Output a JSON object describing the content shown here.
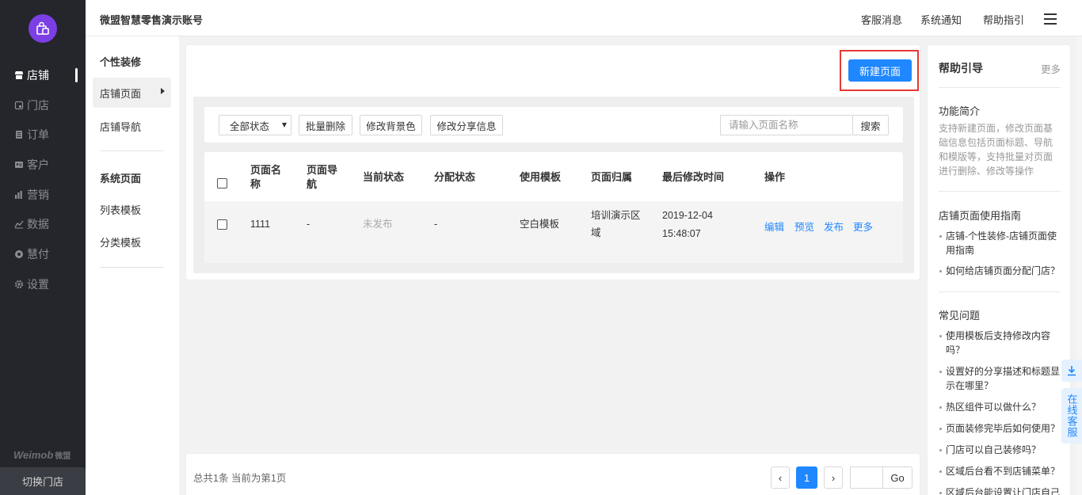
{
  "sidebar": {
    "items": [
      {
        "label": "店铺",
        "icon": "store-icon",
        "active": true
      },
      {
        "label": "门店",
        "icon": "shop-icon",
        "active": false
      },
      {
        "label": "订单",
        "icon": "order-icon",
        "active": false
      },
      {
        "label": "客户",
        "icon": "customer-icon",
        "active": false
      },
      {
        "label": "营销",
        "icon": "marketing-icon",
        "active": false
      },
      {
        "label": "数据",
        "icon": "data-icon",
        "active": false
      },
      {
        "label": "慧付",
        "icon": "pay-icon",
        "active": false
      },
      {
        "label": "设置",
        "icon": "settings-icon",
        "active": false
      }
    ],
    "brand": "Weimob",
    "brand_cn": "微盟",
    "switch_store": "切换门店"
  },
  "topbar": {
    "account_name": "微盟智慧零售演示账号",
    "links": [
      "客服消息",
      "系统通知",
      "帮助指引"
    ]
  },
  "submenu": {
    "head1": "个性装修",
    "items1": [
      "店铺页面",
      "店铺导航"
    ],
    "head2": "系统页面",
    "items2": [
      "列表模板",
      "分类模板"
    ]
  },
  "main": {
    "new_page_button": "新建页面",
    "filters": {
      "status_select": "全部状态",
      "batch_delete": "批量删除",
      "change_bg": "修改背景色",
      "change_share": "修改分享信息",
      "search_placeholder": "请输入页面名称",
      "search_button": "搜索"
    },
    "table": {
      "headers": [
        "页面名称",
        "页面导航",
        "当前状态",
        "分配状态",
        "使用模板",
        "页面归属",
        "最后修改时间",
        "操作"
      ],
      "rows": [
        {
          "name": "1111",
          "nav": "-",
          "status": "未发布",
          "assign": "-",
          "template": "空白模板",
          "owner": "培训演示区域",
          "modified_date": "2019-12-04",
          "modified_time": "15:48:07",
          "actions": [
            "编辑",
            "预览",
            "发布",
            "更多"
          ]
        }
      ]
    }
  },
  "pagination": {
    "info": "总共1条 当前为第1页",
    "prev": "‹",
    "current": "1",
    "next": "›",
    "go": "Go"
  },
  "help": {
    "title": "帮助引导",
    "more": "更多",
    "intro_title": "功能简介",
    "intro_desc": "支持新建页面，修改页面基础信息包括页面标题、导航和模版等，支持批量对页面进行删除、修改等操作",
    "guide_title": "店铺页面使用指南",
    "guide_items": [
      "店铺-个性装修-店铺页面使用指南",
      "如何给店铺页面分配门店？"
    ],
    "faq_title": "常见问题",
    "faq_items": [
      "使用模板后支持修改内容吗？",
      "设置好的分享描述和标题显示在哪里？",
      "热区组件可以做什么？",
      "页面装修完毕后如何使用？",
      "门店可以自己装修吗？",
      "区域后台看不到店铺菜单？",
      "区域后台能设置让门店自己"
    ]
  },
  "service": {
    "online": "在线客服"
  },
  "colors": {
    "primary": "#1f87ff",
    "sidebar_bg": "#24262b",
    "highlight_border": "#e53935",
    "logo_bg": "#7b3fe4"
  }
}
